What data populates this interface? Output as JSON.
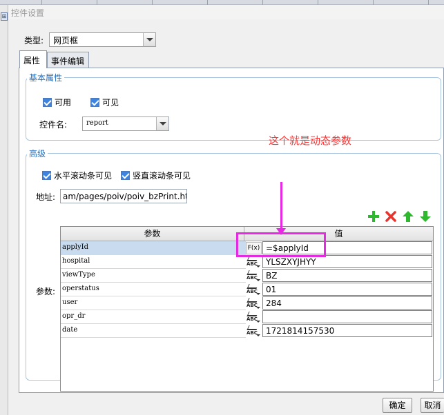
{
  "window": {
    "title": "控件设置"
  },
  "type_row": {
    "label": "类型:",
    "value": "网页框"
  },
  "tabs": [
    {
      "label": "属性"
    },
    {
      "label": "事件编辑"
    }
  ],
  "basic": {
    "title": "基本属性",
    "enabled_label": "可用",
    "visible_label": "可见",
    "name_label": "控件名:",
    "name_value": "report"
  },
  "advanced": {
    "title": "高级",
    "hscroll_label": "水平滚动条可见",
    "vscroll_label": "竖直滚动条可见",
    "address_label": "地址:",
    "address_value": "am/pages/poiv/poiv_bzPrint.html",
    "params_label": "参数:"
  },
  "annotation": {
    "text": "这个就是动态参数"
  },
  "table": {
    "col_param": "参数",
    "col_value": "值",
    "rows": [
      {
        "name": "applyId",
        "icon": "fx",
        "icon_text": "F(x)",
        "value": "=$applyId"
      },
      {
        "name": "hospital",
        "icon": "abc-edit-icon",
        "value": "YLSZXYJHYY"
      },
      {
        "name": "viewType",
        "icon": "abc-edit-icon",
        "value": "BZ"
      },
      {
        "name": "operstatus",
        "icon": "abc-edit-icon",
        "value": "01"
      },
      {
        "name": "user",
        "icon": "abc-edit-icon",
        "value": "284"
      },
      {
        "name": "opr_dr",
        "icon": "abc-edit-icon",
        "value": ""
      },
      {
        "name": "date",
        "icon": "abc-edit-icon",
        "value": "1721814157530"
      }
    ]
  },
  "buttons": {
    "ok": "确定",
    "cancel": "取消"
  },
  "colors": {
    "accent_green": "#2eb82e",
    "accent_red": "#e8322b",
    "annotation": "#ff3535",
    "highlight": "#e829e4"
  }
}
